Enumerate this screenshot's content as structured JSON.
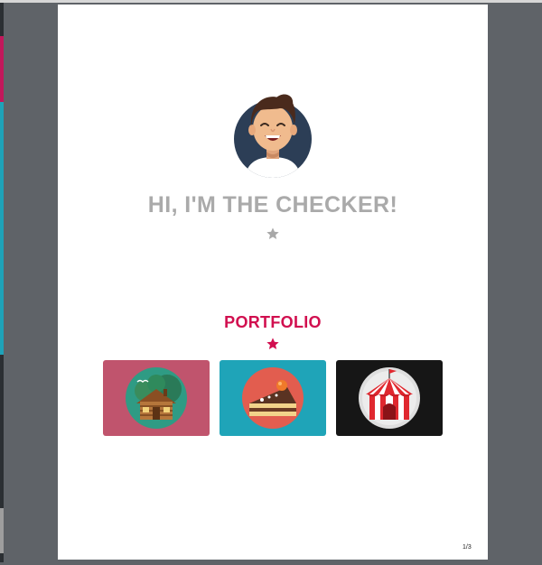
{
  "page": {
    "counter": "1/3"
  },
  "hero": {
    "title": "HI, I'M THE CHECKER!",
    "avatar_icon": "boy-avatar-icon",
    "divider_icon": "star-icon"
  },
  "portfolio": {
    "title": "PORTFOLIO",
    "divider_icon": "star-icon",
    "items": [
      {
        "icon": "log-cabin-icon",
        "background": "#c0546d"
      },
      {
        "icon": "cake-slice-icon",
        "background": "#1fa4b8"
      },
      {
        "icon": "circus-tent-icon",
        "background": "#161616"
      }
    ]
  },
  "colors": {
    "viewer_background": "#5f6368",
    "accent": "#d10f4f",
    "muted_text": "#aaaaaa"
  }
}
